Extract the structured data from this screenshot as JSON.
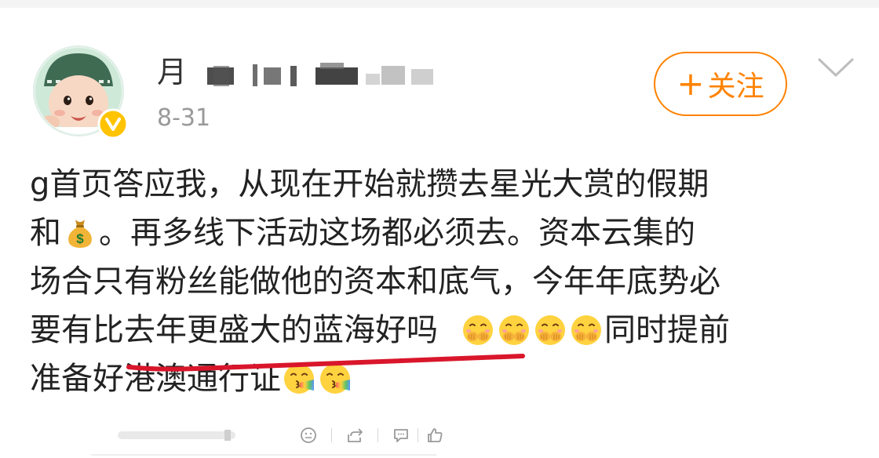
{
  "post": {
    "username_visible": "月",
    "timestamp": "8-31",
    "follow_label": "关注",
    "follow_plus": "+",
    "lines": [
      "g首页答应我，从现在开始就攒去星光大赏的假期",
      "和",
      "。再多线下活动这场都必须去。资本云集的",
      "场合只有粉丝能做他的资本和底气，今年年底势必",
      "要有比去年更盛大的蓝海好吗",
      "同时提前",
      "准备好港澳通行证"
    ]
  },
  "icons": {
    "avatar": "baby-avatar",
    "verified": "verified-v-badge-icon",
    "more": "chevron-down-icon",
    "money": "money-bag-emoji",
    "cover_mouth": "cover-mouth-face-emoji",
    "rainbow_kiss": "rainbow-kiss-face-emoji",
    "footer": [
      "face-icon",
      "share-icon",
      "comment-icon",
      "like-icon"
    ]
  },
  "colors": {
    "accent": "#ff8200",
    "verified": "#ffc300",
    "underline": "#d9162b",
    "text": "#222222",
    "muted": "#999999"
  }
}
